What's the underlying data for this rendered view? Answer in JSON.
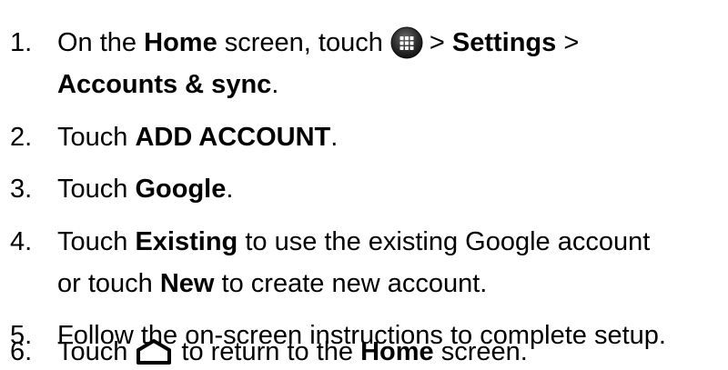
{
  "steps": [
    {
      "number": "1.",
      "line1": {
        "t1": "On the ",
        "b1": "Home",
        "t2": " screen, touch",
        "icon": "apps-grid-icon",
        "t3": "> ",
        "b2": "Settings",
        "t4": " >"
      },
      "line2": {
        "b1": "Accounts & sync",
        "t1": "."
      }
    },
    {
      "number": "2.",
      "t1": "Touch ",
      "b1": "ADD ACCOUNT",
      "t2": "."
    },
    {
      "number": "3.",
      "t1": "Touch ",
      "b1": "Google",
      "t2": "."
    },
    {
      "number": "4.",
      "line1": {
        "t1": "Touch ",
        "b1": "Existing",
        "t2": " to use the existing Google account"
      },
      "line2": {
        "t1": "or touch ",
        "b1": "New",
        "t2": " to create new account."
      }
    },
    {
      "number": "5.",
      "t1": "Follow the on-screen instructions to complete setup."
    },
    {
      "number": "6.",
      "t1": "Touch",
      "icon": "home-outline-icon",
      "t2": "to return to the ",
      "b1": "Home",
      "t3": " screen."
    }
  ]
}
